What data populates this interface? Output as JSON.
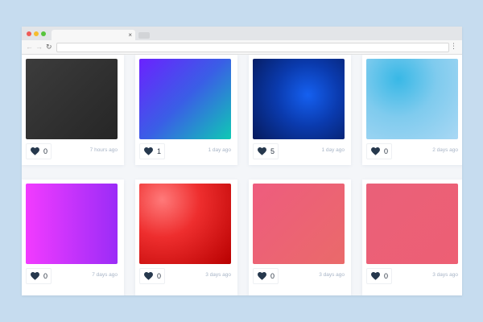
{
  "browser": {
    "title": "",
    "url": "",
    "tab_close": "×",
    "back_icon": "arrow-left-icon",
    "forward_icon": "arrow-right-icon",
    "reload_icon": "reload-icon",
    "menu_icon": "kebab-menu-icon"
  },
  "gallery": {
    "cards": [
      {
        "likes": "0",
        "time": "7 hours ago",
        "gradient": "linear-gradient(135deg,#3c3c3c,#262626)"
      },
      {
        "likes": "1",
        "time": "1 day ago",
        "gradient": "linear-gradient(135deg,#6b22ff 0%,#3a5ee6 50%,#0fc9b4 100%)"
      },
      {
        "likes": "5",
        "time": "1 day ago",
        "gradient": "radial-gradient(circle at 60% 45%,#1560f0 0%,#0a3aad 45%,#061a5c 100%)"
      },
      {
        "likes": "0",
        "time": "2 days ago",
        "gradient": "radial-gradient(circle at 35% 25%,#38b8e6 0%,#7fcbee 45%,#a9d8f4 100%)"
      },
      {
        "likes": "0",
        "time": "7 days ago",
        "gradient": "linear-gradient(90deg,#f23bff,#9b2cf7)"
      },
      {
        "likes": "0",
        "time": "3 days ago",
        "gradient": "radial-gradient(circle at 25% 20%,#ff7a7a 0%,#ee2e2e 40%,#b80000 100%)"
      },
      {
        "likes": "0",
        "time": "3 days ago",
        "gradient": "linear-gradient(135deg,#ee5c7e,#ea6a6a)"
      },
      {
        "likes": "0",
        "time": "3 days ago",
        "gradient": "linear-gradient(135deg,#ea6079,#ed5f74)"
      }
    ]
  },
  "colors": {
    "page_background": "#c6dcef",
    "content_background": "#f4f6f9",
    "heart": "#26384d",
    "timestamp": "#a7b4c6"
  }
}
